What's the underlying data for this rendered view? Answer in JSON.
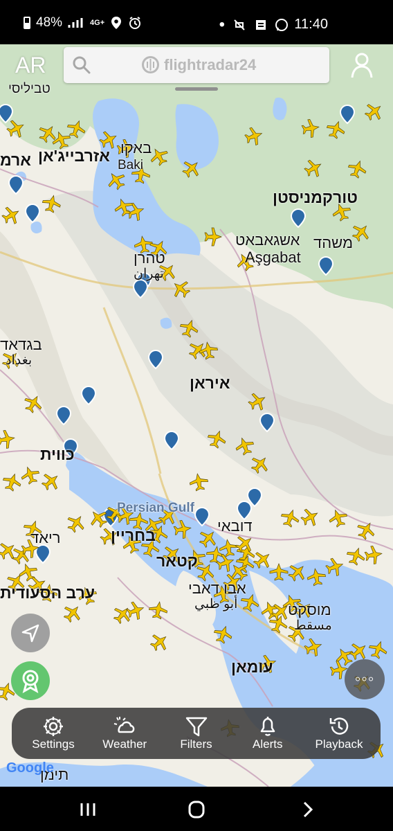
{
  "status_bar": {
    "battery": "48%",
    "network": "4G+",
    "time": "11:40"
  },
  "header": {
    "ar_label": "AR",
    "app_name": "flightradar24"
  },
  "map_labels": {
    "azerbaijan": "אזרבייג'אן",
    "baku_he": "באקו",
    "baku_en": "Baki",
    "turkmenistan": "טורקמניסטן",
    "ashgabat_he": "אשגאבאט",
    "ashgabat_en": "Aşgabat",
    "mashhad": "משהד",
    "tehran_he": "טהרן",
    "tehran_local": "تهران",
    "baghdad_he": "בגדאד",
    "baghdad_local": "بغداد",
    "iran": "איראן",
    "kuwait": "כווית",
    "persian_gulf": "Persian Gulf",
    "riyadh": "ריאד",
    "saudi_arabia": "ערב הסעודית",
    "dubai": "דובאי",
    "abu_dhabi_he": "אבו דאבי",
    "abu_dhabi_local": "أبو ظبي",
    "muscat_he": "מוסקט",
    "muscat_local": "مسقط",
    "qatar": "קטאר",
    "bahrain": "בחריין",
    "oman": "עומאן",
    "yemen": "תימן",
    "tbilisi_partial": "טביליסי",
    "armenia_partial": "ארמ"
  },
  "map_colors": {
    "land": "#f1efe7",
    "water": "#abcdf8",
    "mountain": "#dfe0da",
    "green": "#b9d9b1",
    "plane": "#f1c400",
    "pin": "#2c6aa8"
  },
  "toolbar": {
    "settings": "Settings",
    "weather": "Weather",
    "filters": "Filters",
    "alerts": "Alerts",
    "playback": "Playback"
  },
  "attribution": {
    "google": "Google"
  },
  "icons": {
    "search": "search-icon",
    "user": "user-icon",
    "locate": "navigation-arrow-icon",
    "badge": "award-badge-icon",
    "more": "more-icon",
    "settings": "gear-icon",
    "weather": "cloud-sun-icon",
    "filters": "filter-icon",
    "alerts": "bell-icon",
    "playback": "history-icon",
    "recent": "recent-apps-icon",
    "home": "home-icon",
    "back": "back-icon"
  }
}
